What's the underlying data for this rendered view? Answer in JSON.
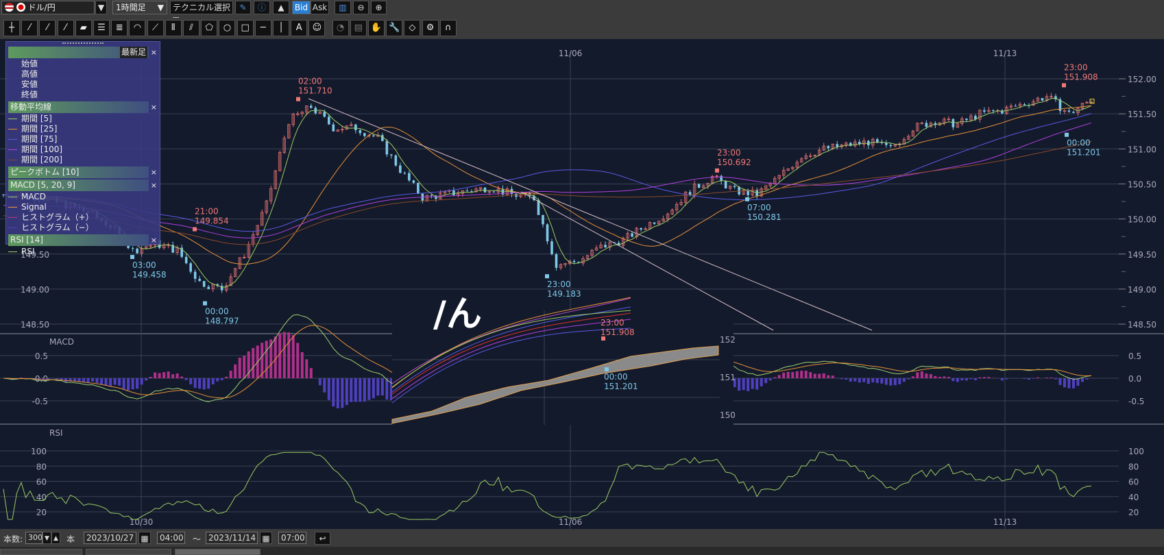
{
  "toolbar": {
    "pair": "ドル/円",
    "timeframe": "1時間足",
    "technical": "テクニカル選択",
    "bid": "Bid",
    "ask": "Ask",
    "icons": [
      "crosshair-icon",
      "trendline-1-icon",
      "trendline-2-icon",
      "trendline-3-icon",
      "ruler-icon",
      "parallel-lines-icon",
      "multi-lines-icon",
      "arc-icon",
      "fan-icon",
      "vertical-lines-icon",
      "gann-fan-icon",
      "pentagon-icon",
      "circle-icon",
      "rectangle-icon",
      "horizontal-line-icon",
      "vertical-line-icon",
      "text-icon",
      "stamp-icon",
      "undo-icon",
      "copy-icon",
      "hand-icon",
      "wrench-icon",
      "eraser-icon",
      "settings-list-icon",
      "magnet-icon"
    ]
  },
  "legend": {
    "latest": "最新足",
    "ohlc": [
      "始値",
      "高値",
      "安値",
      "終値"
    ],
    "ma": {
      "title": "移動平均線",
      "items": [
        {
          "label": "期間 [5]",
          "color": "#9ccc65"
        },
        {
          "label": "期間 [25]",
          "color": "#e8913a"
        },
        {
          "label": "期間 [75]",
          "color": "#5a5ae6"
        },
        {
          "label": "期間 [100]",
          "color": "#b040e0"
        },
        {
          "label": "期間 [200]",
          "color": "#8a4a2a"
        }
      ]
    },
    "peak": "ピークボトム [10]",
    "macd": {
      "title": "MACD [5, 20, 9]",
      "items": [
        {
          "label": "MACD",
          "color": "#9ccc65"
        },
        {
          "label": "Signal",
          "color": "#e8913a"
        },
        {
          "label": "ヒストグラム（+）",
          "color": "#b0308a"
        },
        {
          "label": "ヒストグラム（−）",
          "color": "#5040c0"
        }
      ]
    },
    "rsi": {
      "title": "RSI [14]",
      "items": [
        {
          "label": "RSI",
          "color": "#9ccc65"
        }
      ]
    }
  },
  "axes": {
    "price_ticks": [
      "152.00",
      "151.50",
      "151.00",
      "150.50",
      "150.00",
      "149.50",
      "149.00",
      "148.50"
    ],
    "left_price_ticks": [
      "149.50",
      "149.00",
      "148.50"
    ],
    "macd_ticks": [
      "0.5",
      "0.0",
      "-0.5"
    ],
    "rsi_ticks": [
      "100",
      "80",
      "60",
      "40",
      "20"
    ],
    "top_dates": [
      "11/06",
      "11/13"
    ],
    "bottom_dates": [
      "10/30",
      "11/06",
      "11/13"
    ],
    "macd_label": "MACD",
    "rsi_label": "RSI"
  },
  "annotations": [
    {
      "time": "03:00",
      "price": "149.458",
      "type": "bottom"
    },
    {
      "time": "21:00",
      "price": "149.854",
      "type": "peak"
    },
    {
      "time": "00:00",
      "price": "148.797",
      "type": "bottom"
    },
    {
      "time": "02:00",
      "price": "151.710",
      "type": "peak"
    },
    {
      "time": "23:00",
      "price": "149.183",
      "type": "bottom"
    },
    {
      "time": "23:00",
      "price": "150.692",
      "type": "peak"
    },
    {
      "time": "07:00",
      "price": "150.281",
      "type": "bottom"
    },
    {
      "time": "23:00",
      "price": "151.908",
      "type": "peak"
    },
    {
      "time": "00:00",
      "price": "151.201",
      "type": "bottom"
    }
  ],
  "overlay": {
    "handwriting": "/ん",
    "ticks": [
      "152",
      "151",
      "150"
    ],
    "peak_time": "23:00",
    "peak_price": "151.908",
    "bottom_time": "00:00",
    "bottom_price": "151.201"
  },
  "footer": {
    "count_label": "本数:",
    "count": "300",
    "unit": "本",
    "start_date": "2023/10/27",
    "start_time": "04:00",
    "tilde": "〜",
    "end_date": "2023/11/14",
    "end_time": "07:00"
  },
  "colors": {
    "background": "#131a2b",
    "up_candle": "#e07070",
    "down_candle": "#7ec8e8",
    "peak": "#f07878",
    "bottom": "#7ec8e8",
    "bid_active": "#2a7fd4"
  },
  "chart_data": {
    "type": "candlestick",
    "ylim": [
      148.5,
      152.0
    ],
    "start": "2023/10/27 04:00",
    "end": "2023/11/14 07:00",
    "closes": [
      150.35,
      150.35,
      150.3,
      150.2,
      150.1,
      149.9,
      149.55,
      149.65,
      149.55,
      149.1,
      149.0,
      149.5,
      150.2,
      151.4,
      151.6,
      151.3,
      151.3,
      151.15,
      150.7,
      150.3,
      150.35,
      150.4,
      150.45,
      150.35,
      150.3,
      149.35,
      149.4,
      149.6,
      149.7,
      149.9,
      150.1,
      150.4,
      150.6,
      150.4,
      150.35,
      150.6,
      150.9,
      151.0,
      151.05,
      151.1,
      151.0,
      151.3,
      151.4,
      151.35,
      151.5,
      151.55,
      151.65,
      151.75,
      151.5,
      151.7
    ]
  }
}
